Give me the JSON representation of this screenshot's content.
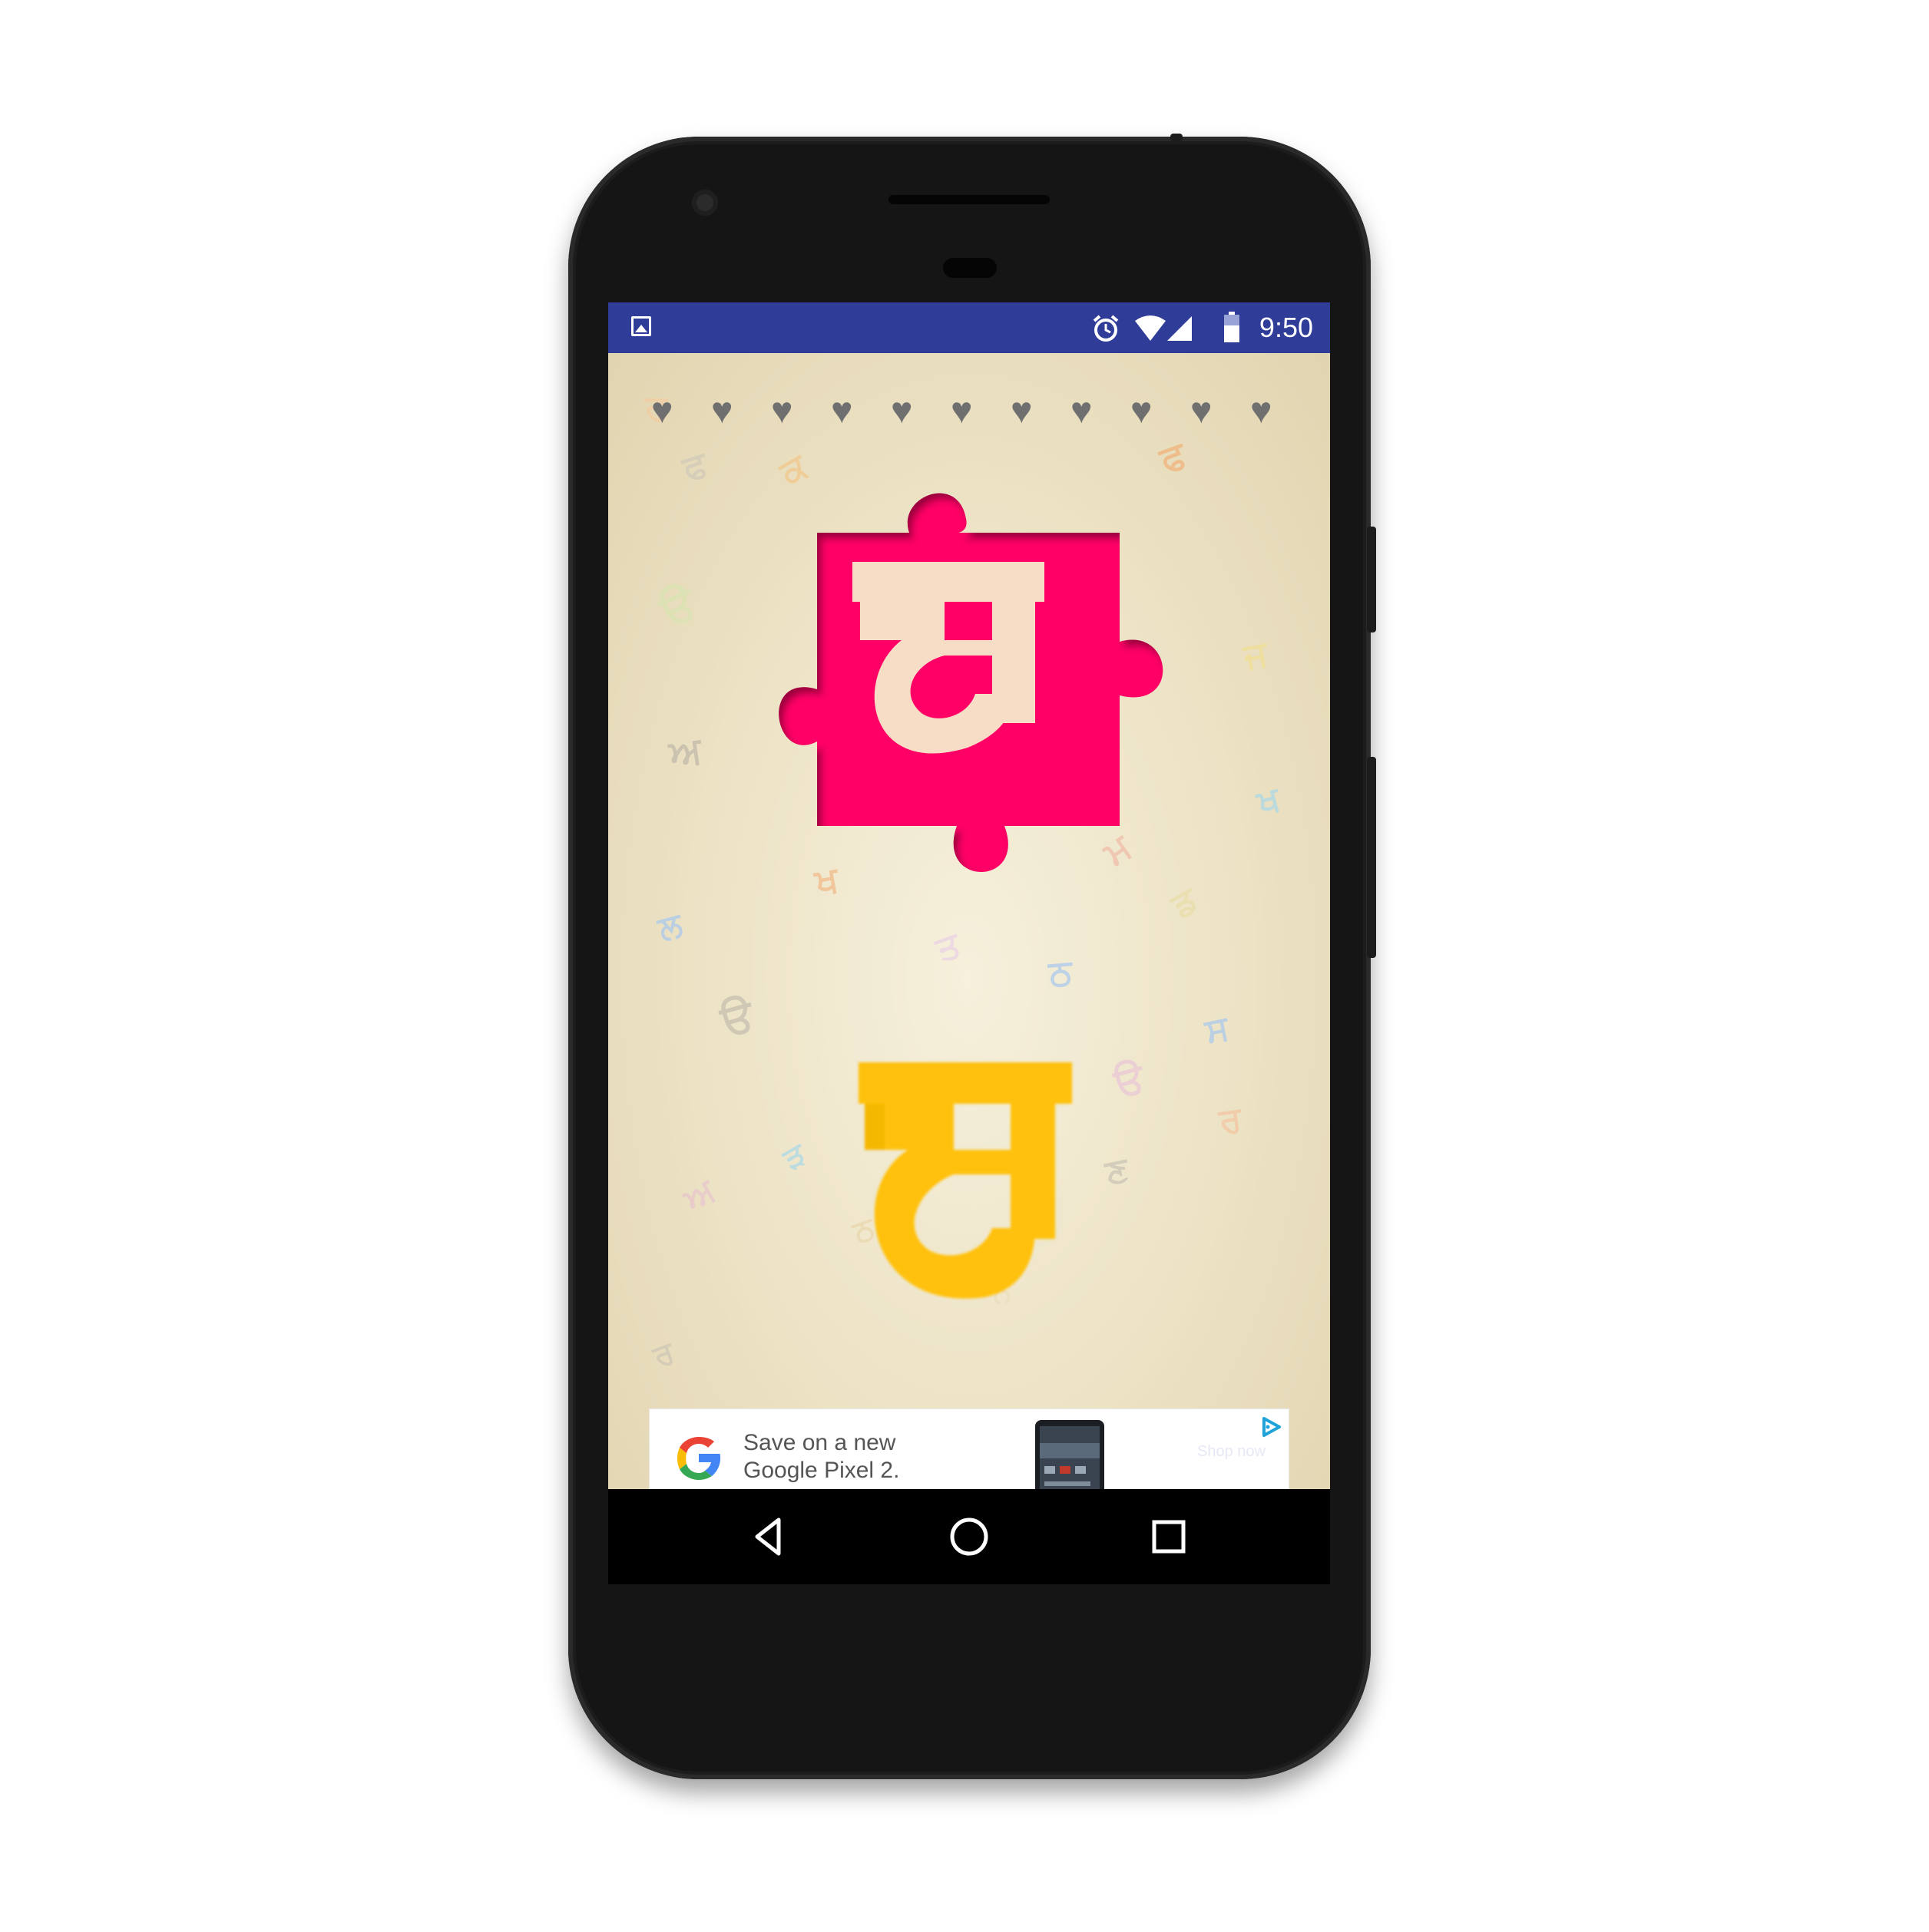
{
  "status_bar": {
    "time": "9:50",
    "icons": [
      "gallery-notification-icon",
      "alarm-icon",
      "wifi-icon",
      "cellular-signal-icon",
      "battery-icon"
    ],
    "background_color": "#2f3d99"
  },
  "game": {
    "lives_total": 11,
    "hearts": [
      "♥",
      "♥",
      "♥",
      "♥",
      "♥",
      "♥",
      "♥",
      "♥",
      "♥",
      "♥",
      "♥"
    ],
    "puzzle_letter": "ਬ",
    "answer_letter": "ਬ",
    "puzzle_color": "#ff0266",
    "puzzle_letter_color": "#f7dcc6",
    "answer_letter_color": "#ffc107",
    "heart_color": "#6f6f6f",
    "background_letters": [
      "ਰ",
      "ਫ",
      "ਫ",
      "ੳ",
      "ਜ",
      "ਅ",
      "ਖ",
      "ਕ",
      "ਮ",
      "ਡ",
      "ਖ",
      "ਲ",
      "ਤ",
      "ਸ",
      "ਰ",
      "ਠ",
      "ੳ",
      "ਣ",
      "ੳ",
      "ੜ",
      "ਅ",
      "ਠ",
      "ਰ",
      "ਨ"
    ]
  },
  "ad": {
    "line1": "Save on a new",
    "line2": "Google Pixel 2.",
    "cta": "Shop now",
    "logo": "google-g-logo",
    "choices_icon": "adchoices-icon"
  },
  "nav": {
    "back": "back-icon",
    "home": "home-icon",
    "recents": "recents-icon"
  }
}
